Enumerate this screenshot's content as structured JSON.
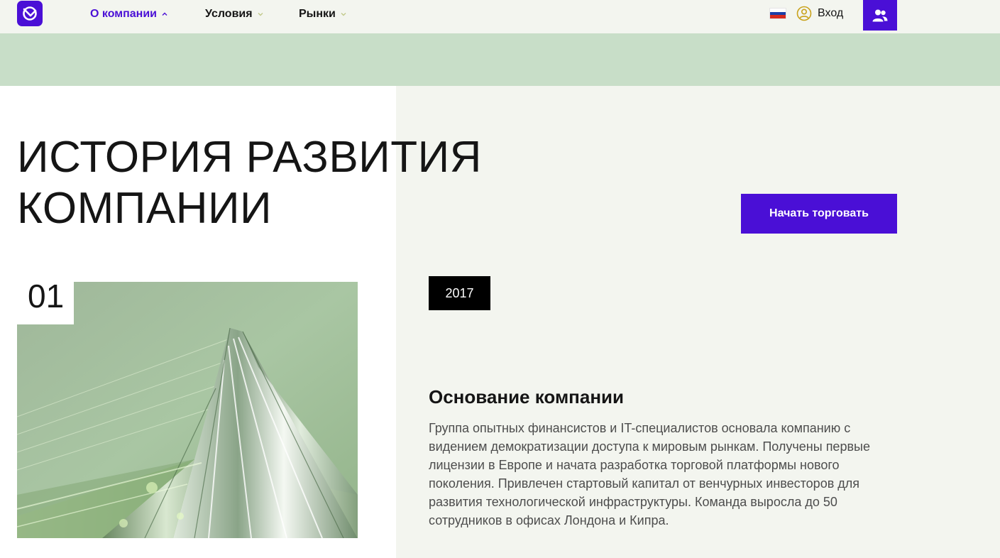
{
  "nav": {
    "items": [
      {
        "label": "О компании",
        "active": true
      },
      {
        "label": "Условия",
        "active": false
      },
      {
        "label": "Рынки",
        "active": false
      }
    ],
    "login_label": "Вход",
    "language": "ru"
  },
  "hero": {
    "title_line1": "История развития",
    "title_line2": "компании",
    "cta_label": "Начать торговать"
  },
  "timeline": {
    "step": "01",
    "year": "2017",
    "heading": "Основание компании",
    "description": "Группа опытных финансистов и IT-специалистов основала компанию с видением демократизации доступа к мировым рынкам. Получены первые лицензии в Европе и начата разработка торговой платформы нового поколения. Привлечен стартовый капитал от венчурных инвесторов для развития технологической инфраструктуры. Команда выросла до 50 сотрудников в офисах Лондона и Кипра."
  },
  "colors": {
    "accent": "#4a0fd6",
    "band": "#c8dec8",
    "panel": "#f3f5ef",
    "year_badge": "#000000"
  },
  "icons": {
    "logo": "brand-logo-icon",
    "chevron": "chevron-icon",
    "flag": "russia-flag-icon",
    "user": "user-circle-icon",
    "register": "users-icon"
  }
}
